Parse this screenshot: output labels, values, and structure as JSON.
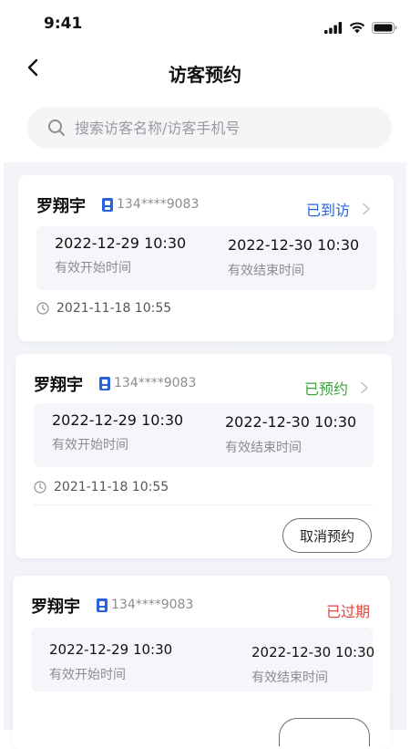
{
  "status_bar": {
    "time": "9:41"
  },
  "header": {
    "title": "访客预约"
  },
  "search": {
    "placeholder": "搜索访客名称/访客手机号",
    "value": ""
  },
  "colors": {
    "arrived": "#2a63d9",
    "booked": "#3aa33a",
    "expired": "#e5453d",
    "phone_icon": "#2a63d9"
  },
  "visits": [
    {
      "name": "罗翔宇",
      "phone": "134****9083",
      "status": "已到访",
      "status_color": "#2a63d9",
      "start_time": "2022-12-29 10:30",
      "start_label": "有效开始时间",
      "end_time": "2022-12-30 10:30",
      "end_label": "有效结束时间",
      "created": "2021-11-18 10:55"
    },
    {
      "name": "罗翔宇",
      "phone": "134****9083",
      "status": "已预约",
      "status_color": "#3aa33a",
      "start_time": "2022-12-29 10:30",
      "start_label": "有效开始时间",
      "end_time": "2022-12-30 10:30",
      "end_label": "有效结束时间",
      "created": "2021-11-18 10:55",
      "action": "取消预约"
    },
    {
      "name": "罗翔宇",
      "phone": "134****9083",
      "status": "已过期",
      "status_color": "#e5453d",
      "start_time": "2022-12-29 10:30",
      "start_label": "有效开始时间",
      "end_time": "2022-12-30 10:30",
      "end_label": "有效结束时间"
    }
  ]
}
